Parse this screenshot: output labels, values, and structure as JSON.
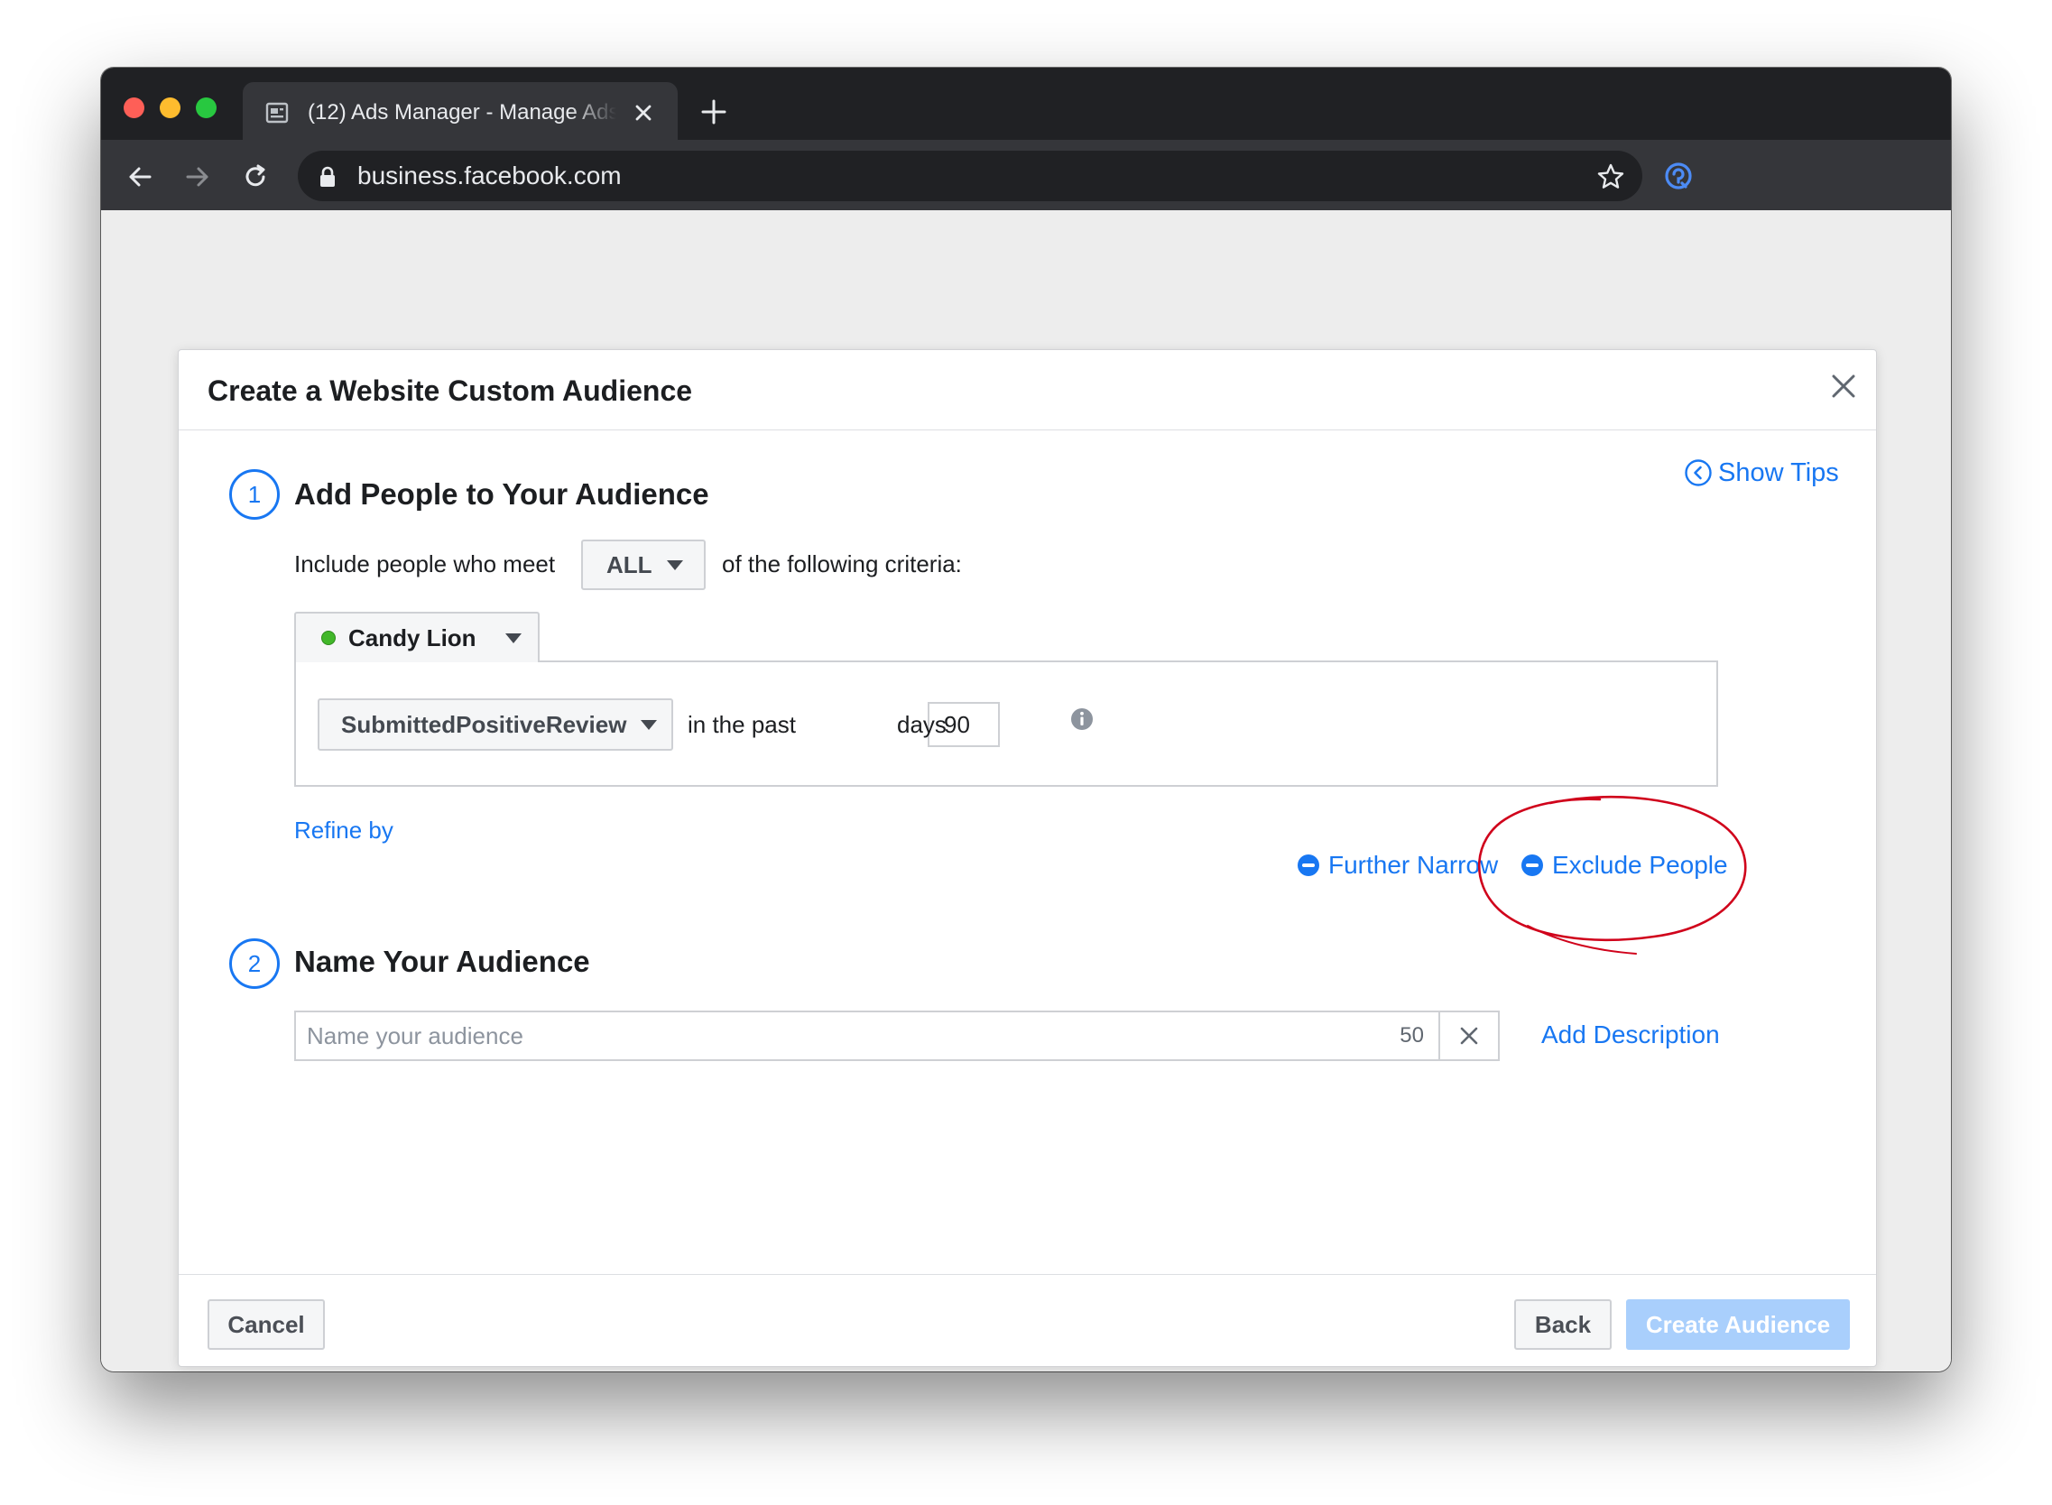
{
  "browser": {
    "tab_title": "(12) Ads Manager - Manage Ads",
    "url": "business.facebook.com"
  },
  "dialog": {
    "title": "Create a Website Custom Audience",
    "show_tips": "Show Tips",
    "step1": {
      "number": "1",
      "title": "Add People to Your Audience",
      "include_prefix": "Include people who meet",
      "match_select": "ALL",
      "include_suffix": "of the following criteria:",
      "pixel_name": "Candy Lion",
      "event_select": "SubmittedPositiveReview",
      "in_the_past": "in the past",
      "days_value": "90",
      "days_label": "days",
      "refine_by": "Refine by",
      "further_narrow": "Further Narrow",
      "exclude_people": "Exclude People"
    },
    "step2": {
      "number": "2",
      "title": "Name Your Audience",
      "name_placeholder": "Name your audience",
      "char_count": "50",
      "add_description": "Add Description"
    },
    "footer": {
      "cancel": "Cancel",
      "back": "Back",
      "create": "Create Audience"
    }
  },
  "colors": {
    "accent": "#1877f2",
    "annotation": "#d0021b",
    "pixel_status": "#42b72a"
  }
}
